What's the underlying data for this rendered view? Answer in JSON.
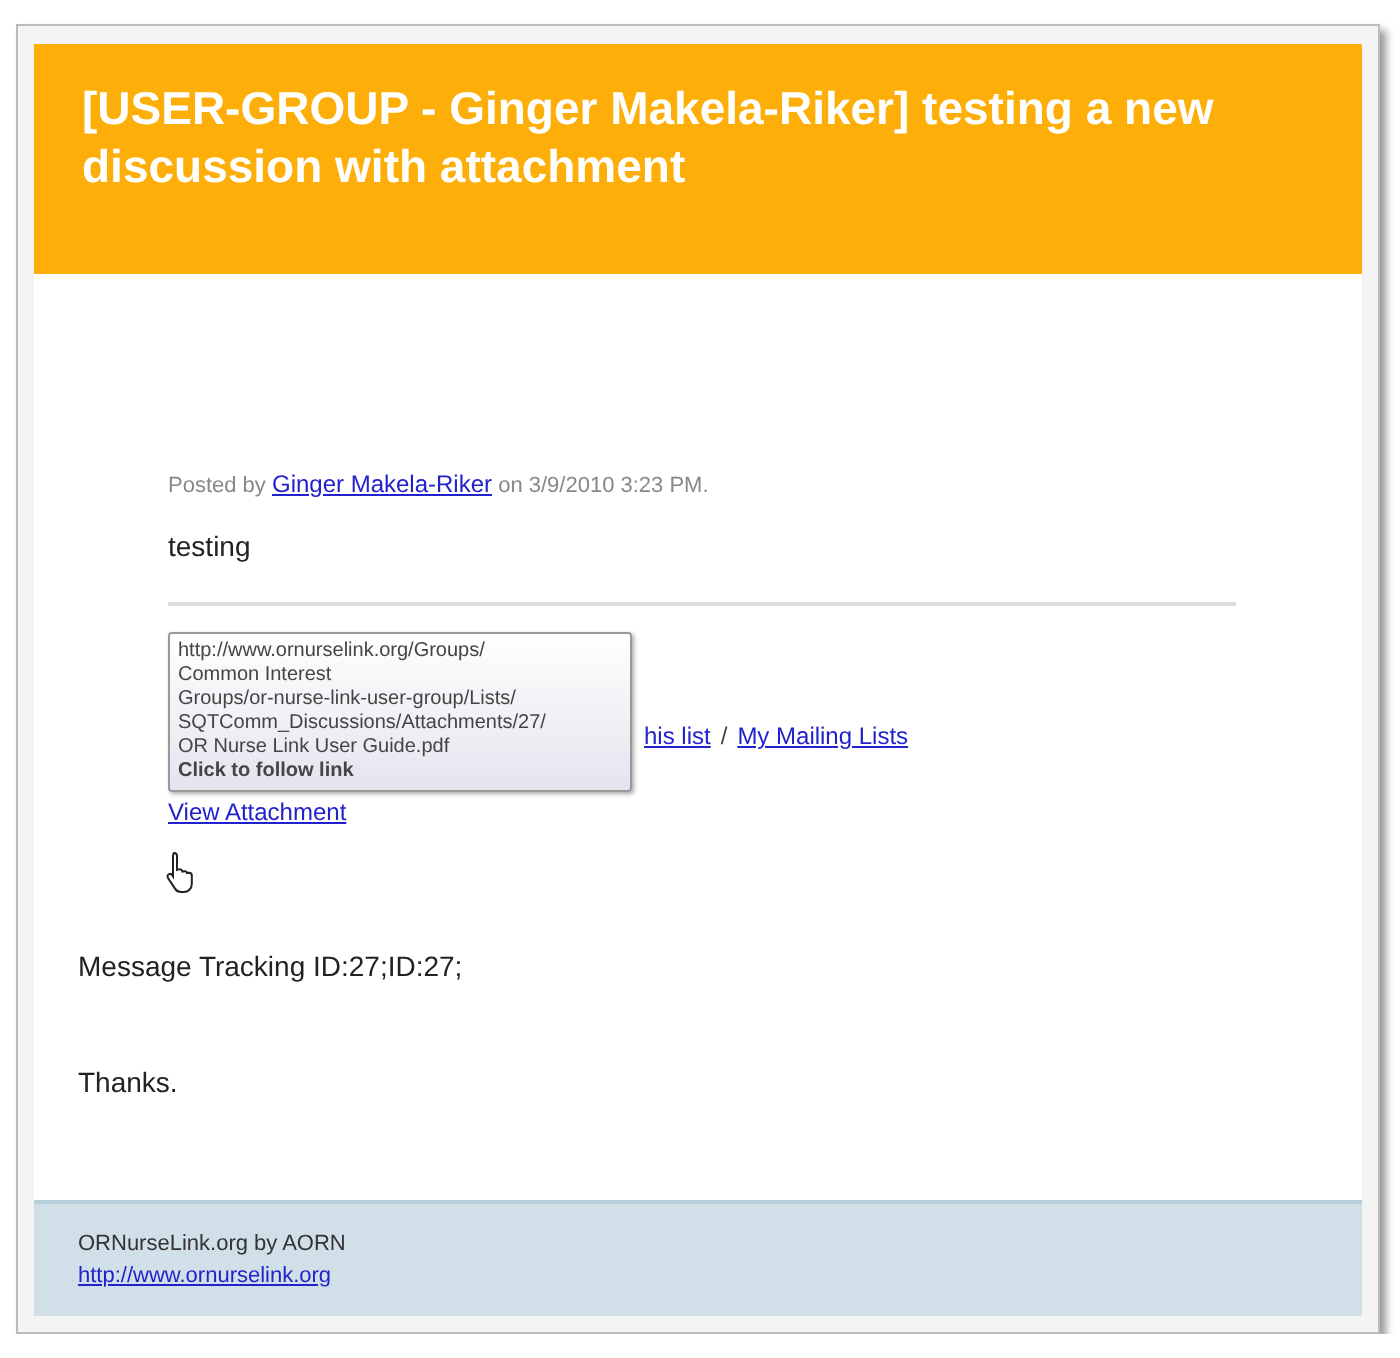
{
  "header": {
    "title": "[USER-GROUP - Ginger Makela-Riker] testing a new discussion with attachment"
  },
  "post": {
    "posted_by_label": "Posted by",
    "author": "Ginger Makela-Riker",
    "posted_on": "on 3/9/2010 3:23 PM.",
    "body": "testing"
  },
  "tooltip": {
    "lines": [
      "http://www.ornurselink.org/Groups/",
      "Common Interest",
      "Groups/or-nurse-link-user-group/Lists/",
      "SQTComm_Discussions/Attachments/27/",
      "OR Nurse Link User Guide.pdf"
    ],
    "hint": "Click to follow link"
  },
  "list_links": [
    {
      "label": "his list"
    },
    {
      "label": "My Mailing Lists"
    }
  ],
  "list_separator": "/",
  "attachment_link": "View Attachment",
  "tracking": "Message Tracking ID:27;ID:27;",
  "closing": "Thanks.",
  "footer": {
    "text": "ORNurseLink.org by AORN",
    "link": "http://www.ornurselink.org"
  }
}
